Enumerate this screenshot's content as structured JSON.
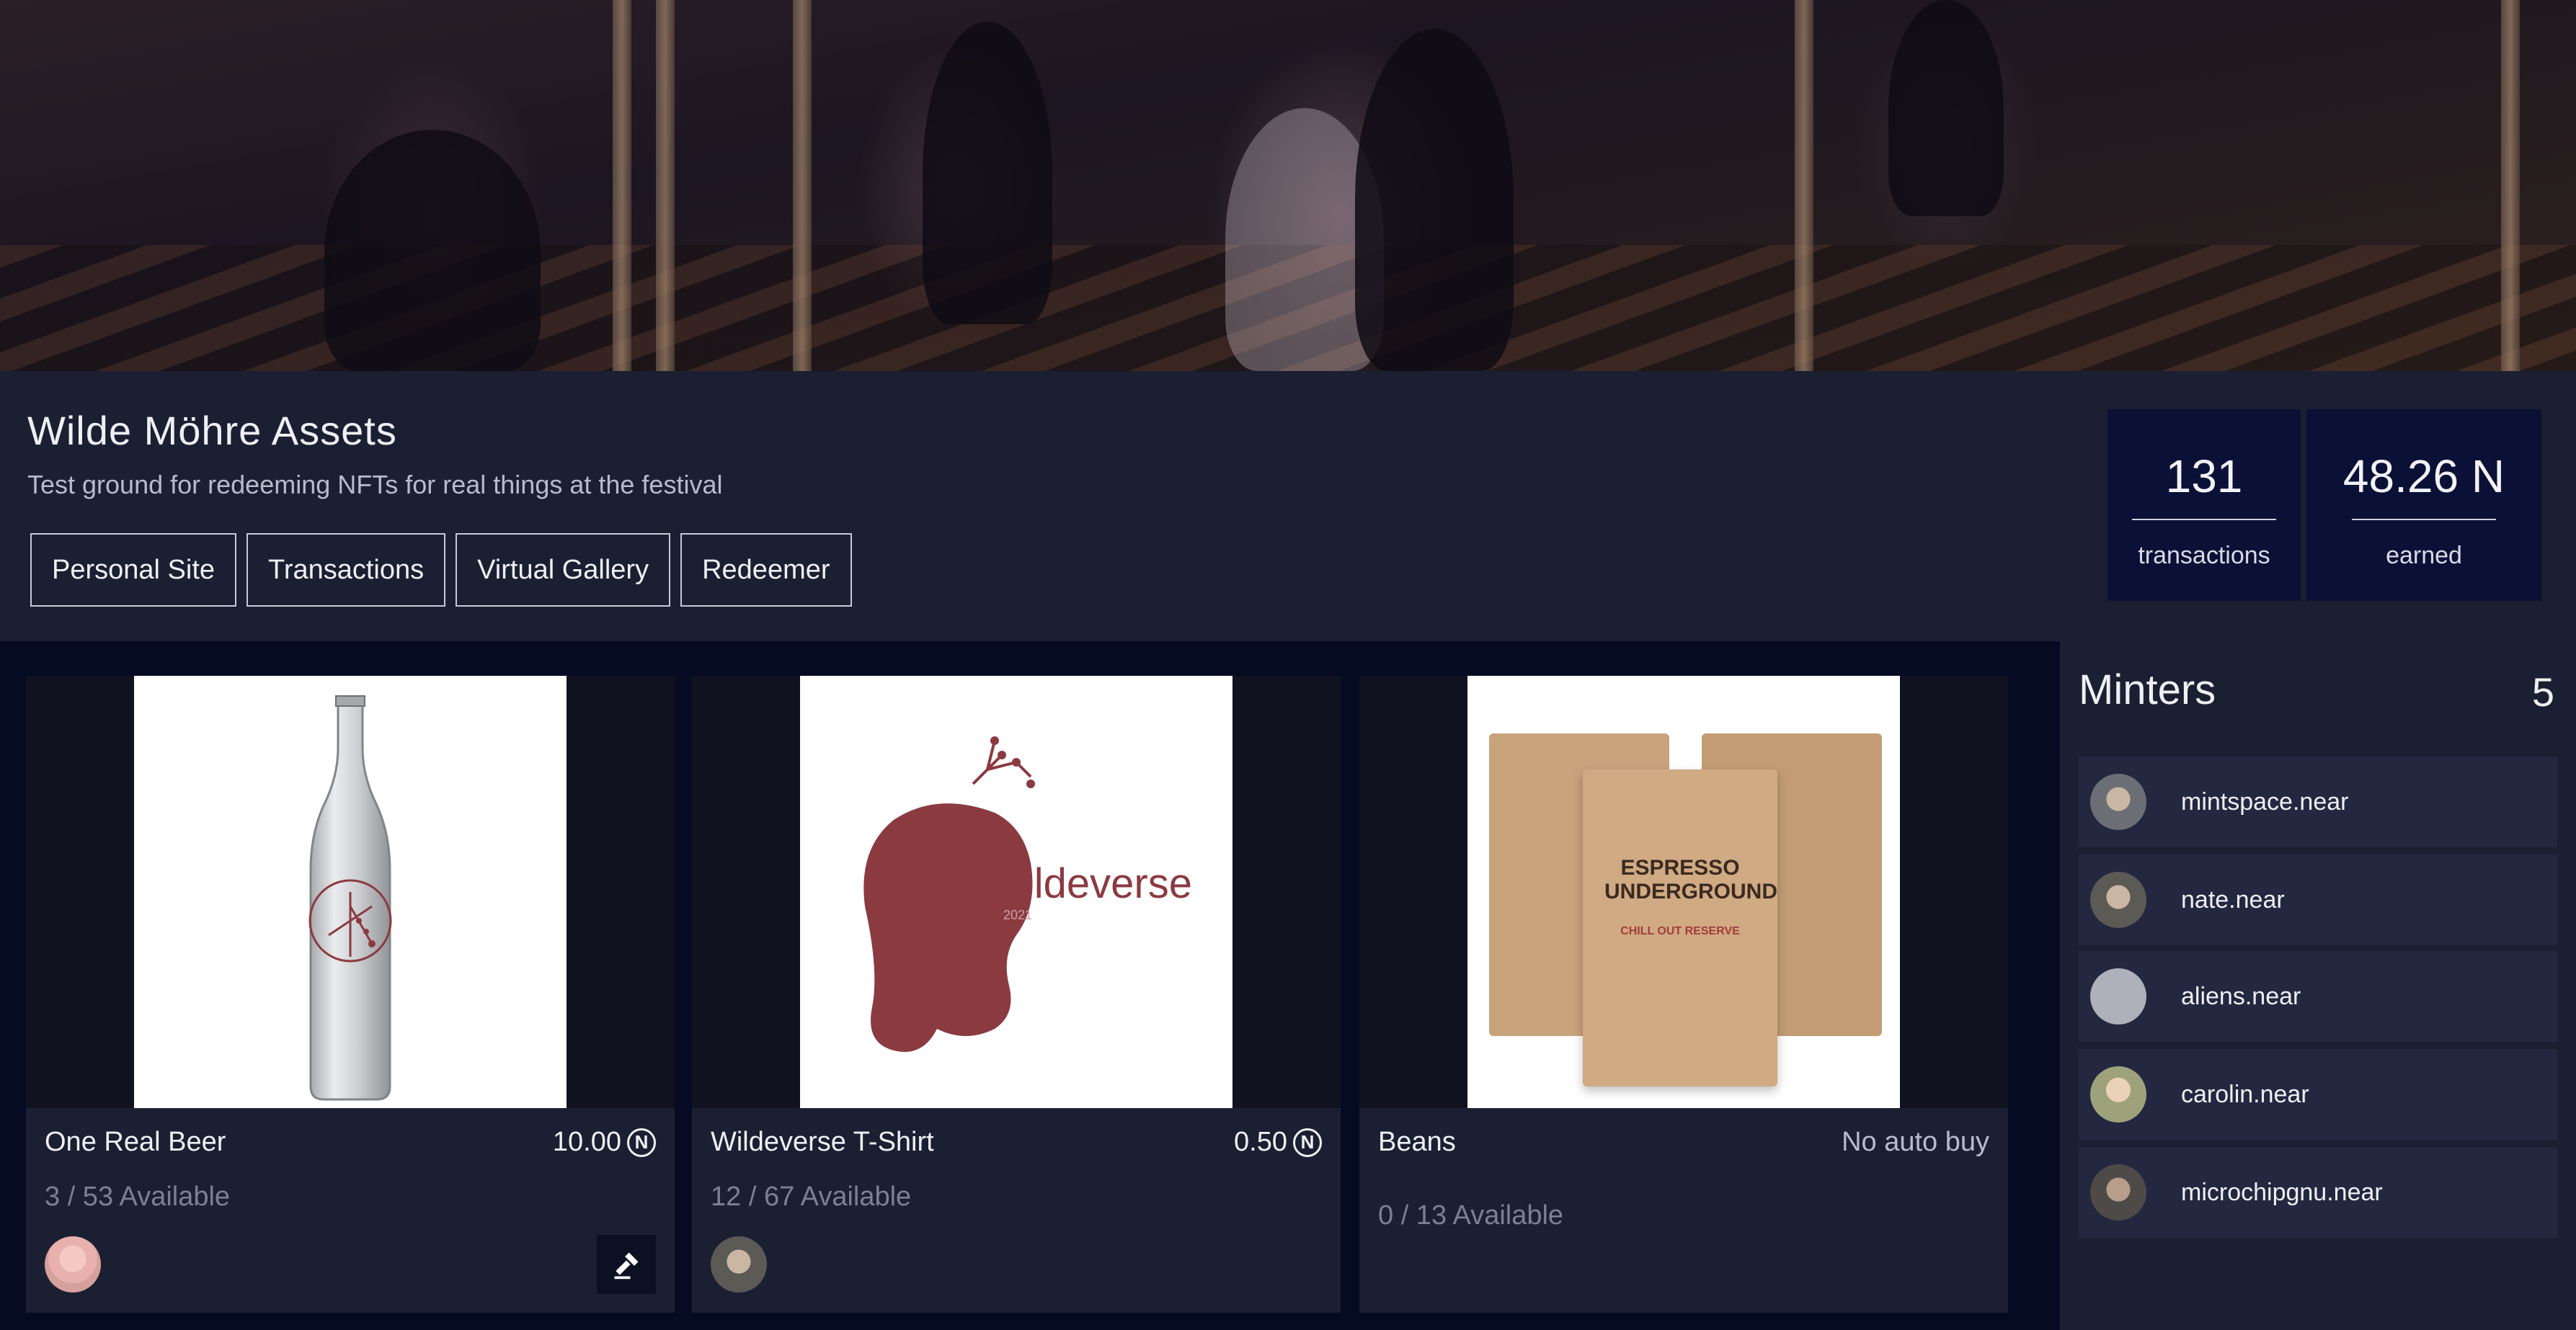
{
  "collection": {
    "title": "Wilde Möhre Assets",
    "description": "Test ground for redeeming NFTs for real things at the festival"
  },
  "nav": [
    "Personal Site",
    "Transactions",
    "Virtual Gallery",
    "Redeemer"
  ],
  "stats": [
    {
      "value": "131",
      "label": "transactions"
    },
    {
      "value": "48.26 N",
      "label": "earned"
    }
  ],
  "cards": [
    {
      "title": "One Real Beer",
      "price": "10.00",
      "currency_icon": "near-icon",
      "availability": "3 / 53 Available",
      "has_redeem_button": true
    },
    {
      "title": "Wildeverse T-Shirt",
      "price": "0.50",
      "currency_icon": "near-icon",
      "availability": "12 / 67 Available",
      "image_text": "wildeverse",
      "image_subtext": "2021"
    },
    {
      "title": "Beans",
      "price": "No auto buy",
      "availability": "0 / 13 Available",
      "image_text": "ESPRESSO UNDERGROUND",
      "image_subtext": "CHILL OUT RESERVE"
    }
  ],
  "minters": {
    "title": "Minters",
    "count": "5",
    "items": [
      {
        "name": "mintspace.near",
        "avatar_color": "#6b6f75"
      },
      {
        "name": "nate.near",
        "avatar_color": "#5b5a55"
      },
      {
        "name": "aliens.near",
        "avatar_color": "#aeb0ba"
      },
      {
        "name": "carolin.near",
        "avatar_color": "#9ea27a"
      },
      {
        "name": "microchipgnu.near",
        "avatar_color": "#4d4a48"
      }
    ]
  },
  "colors": {
    "background": "#060b24",
    "panel": "#1b1f32",
    "stat_box": "#0b1136",
    "brand_red": "#8b3a40"
  }
}
